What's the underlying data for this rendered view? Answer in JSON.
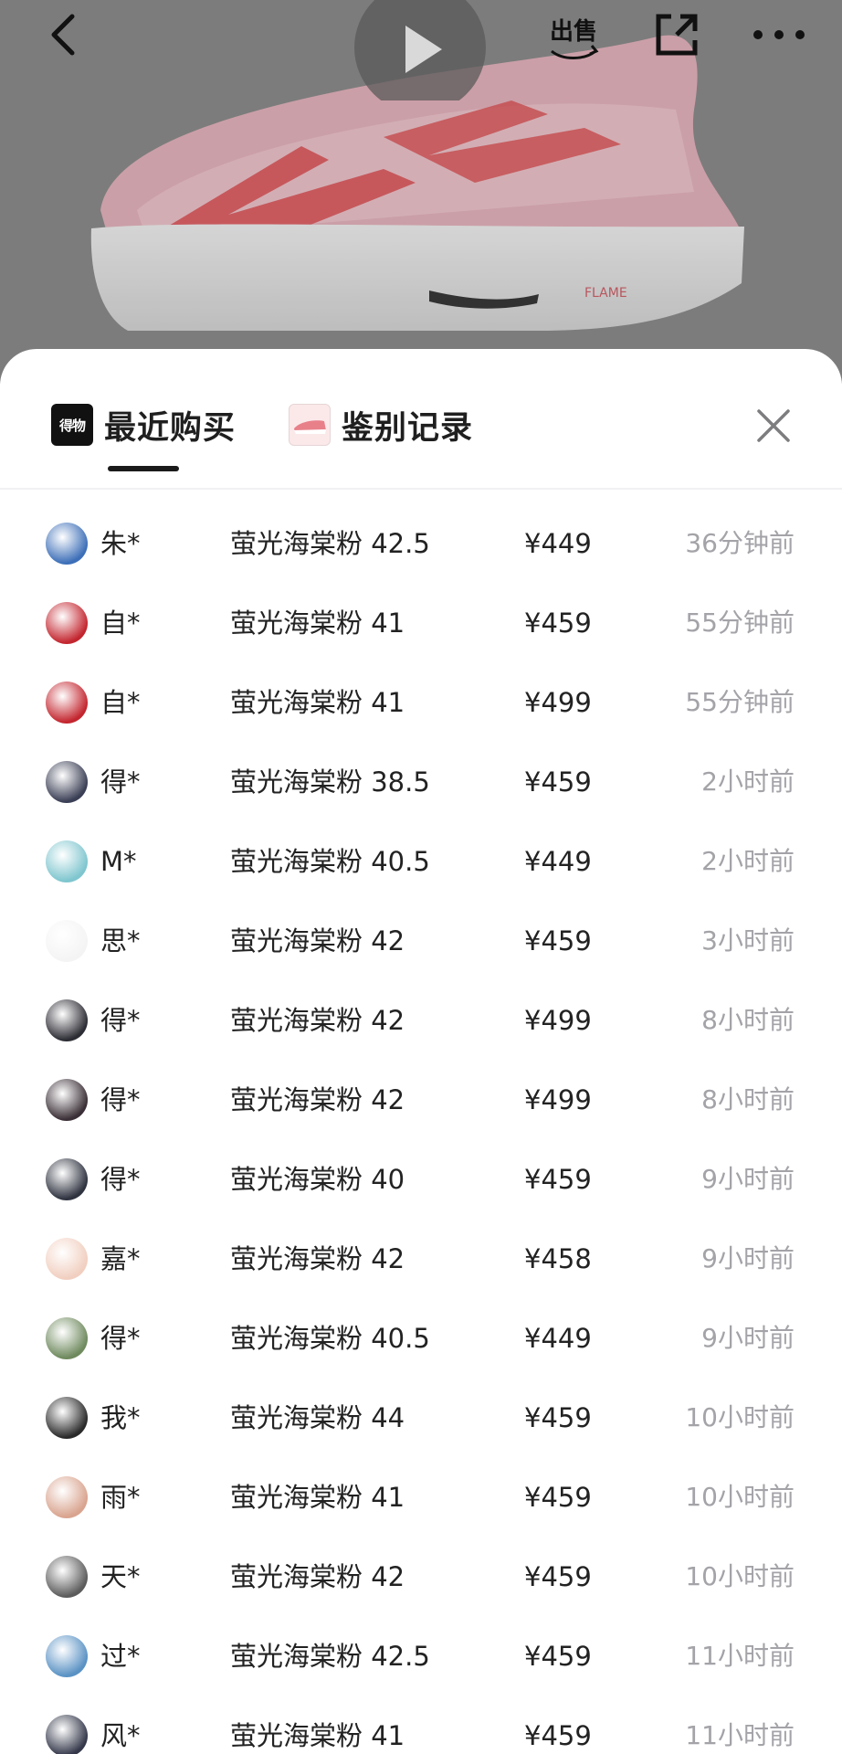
{
  "header": {
    "back_icon": "chevron-left-icon",
    "play_icon": "play-icon",
    "sell_label": "出售",
    "share_icon": "share-external-icon",
    "more_icon": "more-horizontal-icon",
    "shoe_brand_text": "FLAME"
  },
  "tabs": [
    {
      "label": "最近购买",
      "icon": "dewu-logo-icon",
      "logo_text": "得物",
      "active": true
    },
    {
      "label": "鉴别记录",
      "icon": "shoe-thumbnail-icon",
      "active": false
    }
  ],
  "close_icon": "close-icon",
  "purchases": [
    {
      "name": "朱*",
      "product": "萤光海棠粉 42.5",
      "price": "¥449",
      "time": "36分钟前",
      "avatar_color": "#3d6fb8"
    },
    {
      "name": "自*",
      "product": "萤光海棠粉 41",
      "price": "¥459",
      "time": "55分钟前",
      "avatar_color": "#c3262f"
    },
    {
      "name": "自*",
      "product": "萤光海棠粉 41",
      "price": "¥499",
      "time": "55分钟前",
      "avatar_color": "#c3262f"
    },
    {
      "name": "得*",
      "product": "萤光海棠粉 38.5",
      "price": "¥459",
      "time": "2小时前",
      "avatar_color": "#3b3f55"
    },
    {
      "name": "M*",
      "product": "萤光海棠粉 40.5",
      "price": "¥449",
      "time": "2小时前",
      "avatar_color": "#7fc6cf"
    },
    {
      "name": "思*",
      "product": "萤光海棠粉 42",
      "price": "¥459",
      "time": "3小时前",
      "avatar_color": "#f4f4f4"
    },
    {
      "name": "得*",
      "product": "萤光海棠粉 42",
      "price": "¥499",
      "time": "8小时前",
      "avatar_color": "#2c2c34"
    },
    {
      "name": "得*",
      "product": "萤光海棠粉 42",
      "price": "¥499",
      "time": "8小时前",
      "avatar_color": "#3a2f36"
    },
    {
      "name": "得*",
      "product": "萤光海棠粉 40",
      "price": "¥459",
      "time": "9小时前",
      "avatar_color": "#2f3340"
    },
    {
      "name": "嘉*",
      "product": "萤光海棠粉 42",
      "price": "¥458",
      "time": "9小时前",
      "avatar_color": "#f1cfc0"
    },
    {
      "name": "得*",
      "product": "萤光海棠粉 40.5",
      "price": "¥449",
      "time": "9小时前",
      "avatar_color": "#6f8a5e"
    },
    {
      "name": "我*",
      "product": "萤光海棠粉 44",
      "price": "¥459",
      "time": "10小时前",
      "avatar_color": "#2a2a2a"
    },
    {
      "name": "雨*",
      "product": "萤光海棠粉 41",
      "price": "¥459",
      "time": "10小时前",
      "avatar_color": "#d9a48f"
    },
    {
      "name": "天*",
      "product": "萤光海棠粉 42",
      "price": "¥459",
      "time": "10小时前",
      "avatar_color": "#5c5c5c"
    },
    {
      "name": "过*",
      "product": "萤光海棠粉 42.5",
      "price": "¥459",
      "time": "11小时前",
      "avatar_color": "#5a92c4"
    },
    {
      "name": "风*",
      "product": "萤光海棠粉 41",
      "price": "¥459",
      "time": "11小时前",
      "avatar_color": "#34384a"
    }
  ]
}
